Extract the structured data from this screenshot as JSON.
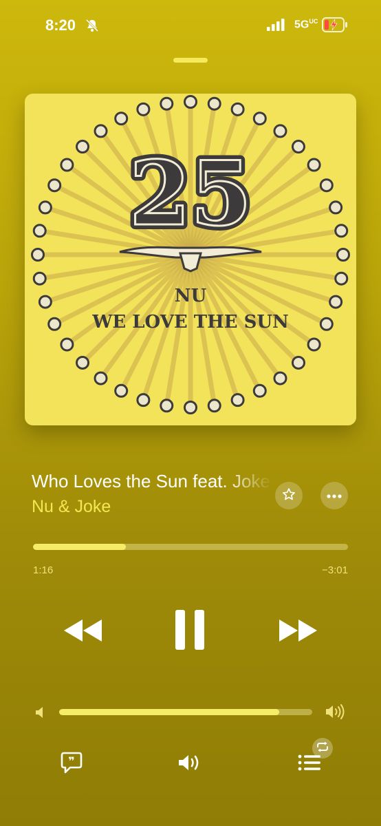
{
  "status_bar": {
    "time": "8:20",
    "network": "5G",
    "network_sup": "UC"
  },
  "album": {
    "number": "25",
    "line1": "NU",
    "line2": "WE LOVE THE SUN"
  },
  "track": {
    "title": "Who Loves the Sun feat. Joke",
    "artist": "Nu & Joke"
  },
  "playback": {
    "elapsed": "1:16",
    "remaining": "−3:01",
    "progress_fraction": 0.295,
    "volume_fraction": 0.87,
    "state": "playing"
  },
  "icons": {
    "mute": "bell-slash-icon",
    "star": "star-icon",
    "more": "ellipsis-icon",
    "rewind": "backward-icon",
    "pause": "pause-icon",
    "forward": "forward-icon",
    "lyrics": "lyrics-quote-icon",
    "airplay": "speaker-icon",
    "queue": "list-icon",
    "repeat": "repeat-icon"
  },
  "colors": {
    "accent": "#f6ec68",
    "background": "#b9a40a",
    "artwork_bg": "#f3e35a",
    "artwork_ink": "#3c3a3a"
  }
}
